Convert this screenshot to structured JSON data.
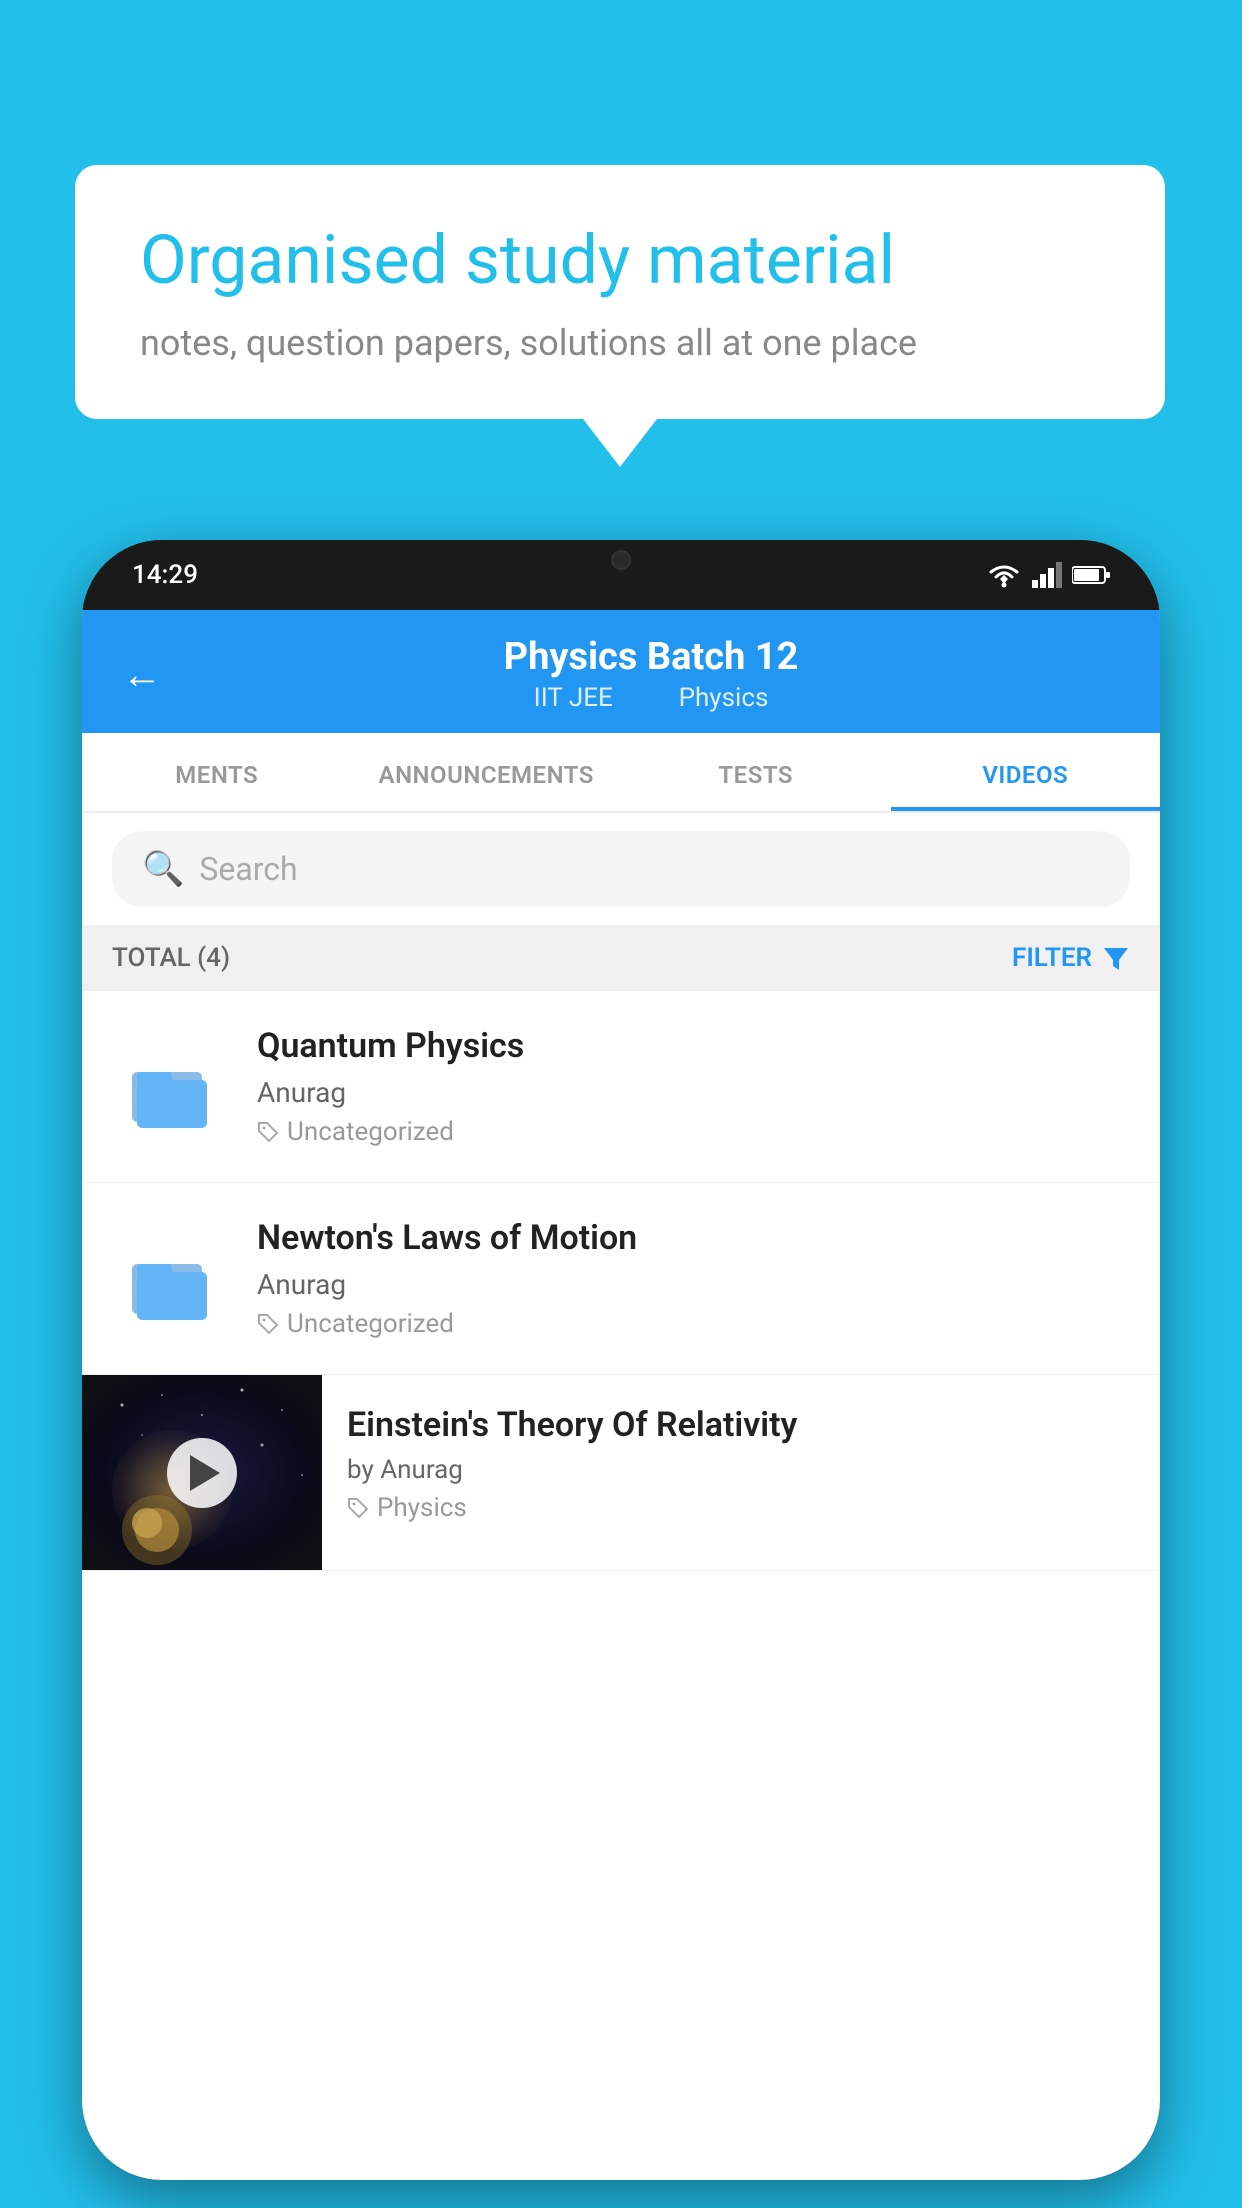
{
  "background_color": "#22BFEA",
  "bubble": {
    "title": "Organised study material",
    "subtitle": "notes, question papers, solutions all at one place"
  },
  "status_bar": {
    "time": "14:29"
  },
  "app_header": {
    "title": "Physics Batch 12",
    "subtitle_left": "IIT JEE",
    "subtitle_right": "Physics"
  },
  "tabs": [
    {
      "label": "MENTS",
      "active": false
    },
    {
      "label": "ANNOUNCEMENTS",
      "active": false
    },
    {
      "label": "TESTS",
      "active": false
    },
    {
      "label": "VIDEOS",
      "active": true
    }
  ],
  "search": {
    "placeholder": "Search"
  },
  "filter_bar": {
    "total_label": "TOTAL (4)",
    "filter_label": "FILTER"
  },
  "videos": [
    {
      "id": 1,
      "title": "Quantum Physics",
      "author": "Anurag",
      "tag": "Uncategorized",
      "has_thumbnail": false
    },
    {
      "id": 2,
      "title": "Newton's Laws of Motion",
      "author": "Anurag",
      "tag": "Uncategorized",
      "has_thumbnail": false
    },
    {
      "id": 3,
      "title": "Einstein's Theory Of Relativity",
      "author": "by Anurag",
      "tag": "Physics",
      "has_thumbnail": true
    }
  ]
}
